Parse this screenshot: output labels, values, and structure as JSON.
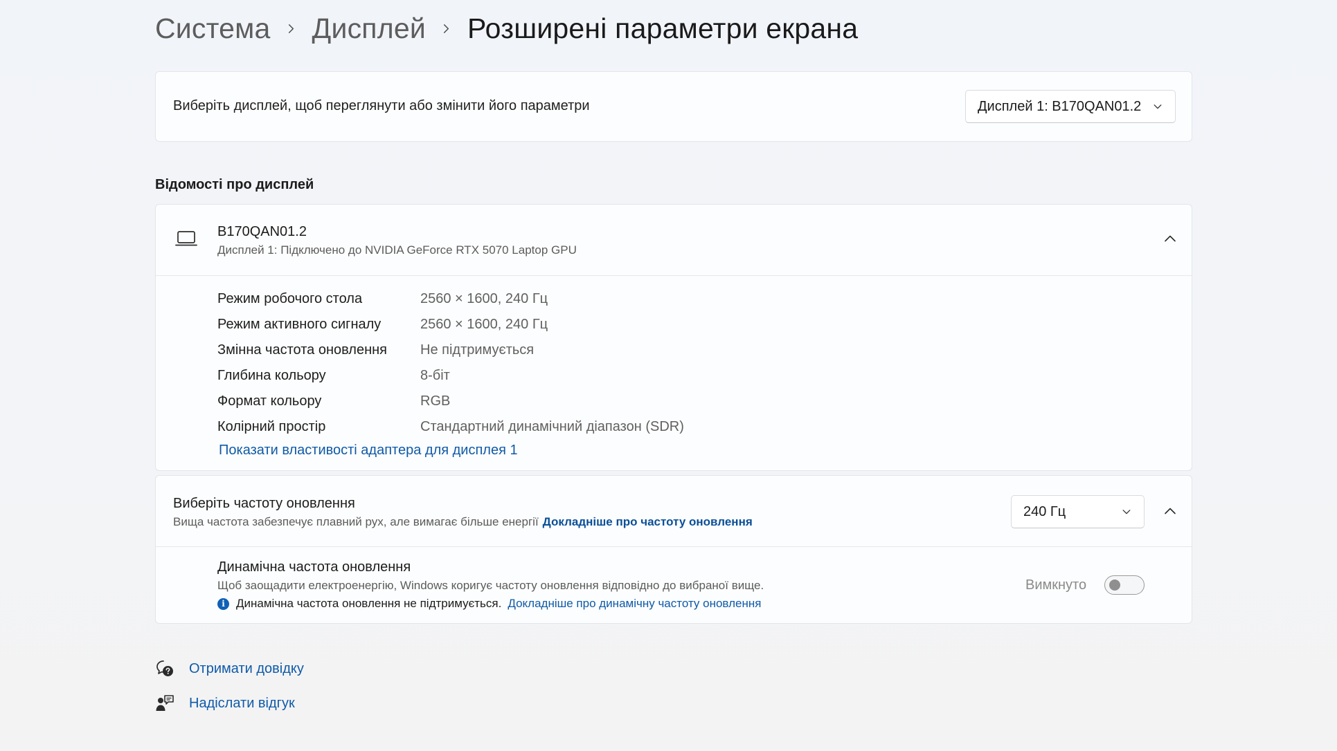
{
  "breadcrumb": {
    "items": [
      "Система",
      "Дисплей",
      "Розширені параметри екрана"
    ]
  },
  "select_display": {
    "label": "Виберіть дисплей, щоб переглянути або змінити його параметри",
    "dropdown_value": "Дисплей 1: B170QAN01.2"
  },
  "display_info": {
    "section_title": "Відомості про дисплей",
    "name": "B170QAN01.2",
    "subtitle": "Дисплей 1: Підключено до NVIDIA GeForce RTX 5070 Laptop GPU",
    "properties": [
      {
        "name": "Режим робочого стола",
        "value": "2560 × 1600, 240 Гц"
      },
      {
        "name": "Режим активного сигналу",
        "value": "2560 × 1600, 240 Гц"
      },
      {
        "name": "Змінна частота оновлення",
        "value": "Не підтримується"
      },
      {
        "name": "Глибина кольору",
        "value": "8-біт"
      },
      {
        "name": "Формат кольору",
        "value": "RGB"
      },
      {
        "name": "Колірний простір",
        "value": "Стандартний динамічний діапазон (SDR)"
      }
    ],
    "adapter_link": "Показати властивості адаптера для дисплея 1"
  },
  "refresh_rate": {
    "title": "Виберіть частоту оновлення",
    "subtitle": "Вища частота забезпечує плавний рух, але вимагає більше енергії",
    "learn_more": "Докладніше про частоту оновлення",
    "dropdown_value": "240 Гц",
    "dynamic": {
      "title": "Динамічна частота оновлення",
      "subtitle": "Щоб заощадити електроенергію, Windows коригує частоту оновлення відповідно до вибраної вище.",
      "note": "Динамічна частота оновлення не підтримується.",
      "note_link": "Докладніше про динамічну частоту оновлення",
      "toggle_label": "Вимкнуто",
      "toggle_on": false
    }
  },
  "footer": {
    "help": "Отримати довідку",
    "feedback": "Надіслати відгук"
  },
  "colors": {
    "accent": "#0e5aa7",
    "info_badge": "#0f60b6"
  }
}
